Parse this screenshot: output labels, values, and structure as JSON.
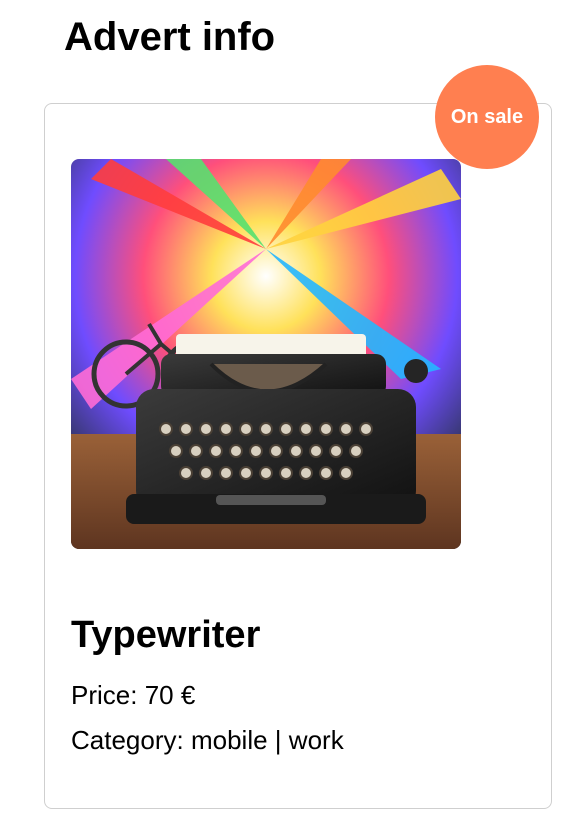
{
  "page": {
    "title": "Advert info"
  },
  "advert": {
    "badge": "On sale",
    "product_name": "Typewriter",
    "price_label": "Price:",
    "price_value": "70",
    "currency": "€",
    "category_label": "Category:",
    "categories": [
      "mobile",
      "work"
    ],
    "category_separator": "|"
  },
  "colors": {
    "badge_bg": "#ff7f50",
    "badge_text": "#ffffff",
    "card_border": "#cfcfcf"
  }
}
